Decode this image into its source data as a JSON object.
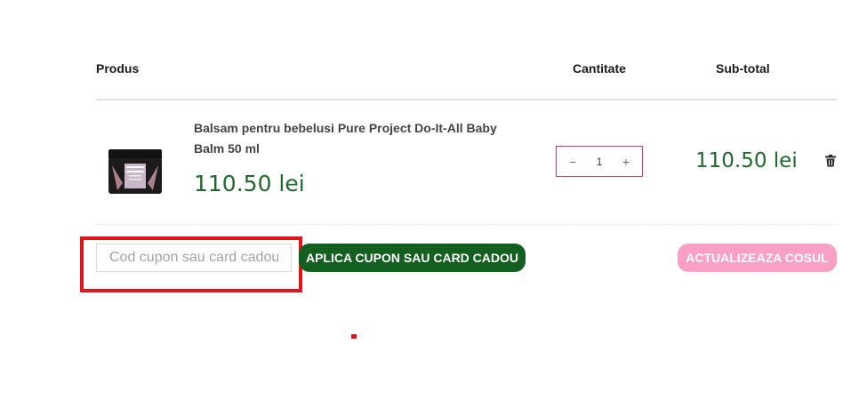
{
  "table": {
    "headers": {
      "product": "Produs",
      "quantity": "Cantitate",
      "subtotal": "Sub-total"
    }
  },
  "item": {
    "name": "Balsam pentru bebelusi Pure Project Do-It-All Baby Balm 50 ml",
    "price": "110.50 lei",
    "quantity": "1",
    "subtotal": "110.50 lei",
    "thumb_label": "PURE PROJECT"
  },
  "coupon": {
    "placeholder": "Cod cupon sau card cadou",
    "value": ""
  },
  "buttons": {
    "apply": "APLICA CUPON SAU CARD CADOU",
    "update": "ACTUALIZEAZA COSUL",
    "decrement": "−",
    "increment": "+"
  },
  "icons": {
    "trash": "trash-icon",
    "thumbnail": "product-thumbnail"
  },
  "colors": {
    "price_green": "#1e6a2c",
    "apply_bg": "#135f20",
    "update_bg": "#f8a1c4",
    "qty_border": "#d4366b",
    "highlight": "#e0151b"
  }
}
